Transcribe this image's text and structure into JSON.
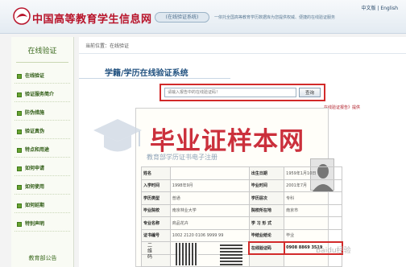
{
  "header": {
    "site_title": "中国高等教育学生信息网",
    "url_badge": "(在线验证系统)",
    "slogan": "一依托全国高等教育学历数据库为您提供权威、便捷的在线验证服务",
    "lang_zh": "中文版",
    "lang_sep": " | ",
    "lang_en": "English"
  },
  "sidebar": {
    "title": "在线验证",
    "items": [
      {
        "label": "在线验证"
      },
      {
        "label": "验证服务简介"
      },
      {
        "label": "防伪措施"
      },
      {
        "label": "验证真伪"
      },
      {
        "label": "特点和用途"
      },
      {
        "label": "如何申请"
      },
      {
        "label": "如何使用"
      },
      {
        "label": "如何延期"
      },
      {
        "label": "特别声明"
      }
    ],
    "footer": "教育部公告"
  },
  "main": {
    "breadcrumb": "当前位置：在线验证",
    "title": "学籍/学历在线验证系统",
    "search_placeholder": "请输入报告中的在线验证码！",
    "search_button": "查询",
    "report_link": "在线验证报告》提供"
  },
  "certificate": {
    "rows": [
      [
        "姓名",
        "",
        "出生日期",
        "1959年1月10日"
      ],
      [
        "入学时间",
        "1998年9月",
        "毕业时间",
        "2001年7月"
      ],
      [
        "学历类型",
        "普通",
        "学历层次",
        "专科"
      ],
      [
        "毕业院校",
        "南京林业大学",
        "院校所在地",
        "南京市"
      ],
      [
        "专业名称",
        "商品花卉",
        "学 习 形 式",
        ""
      ],
      [
        "证书编号",
        "1002 2120 0106 9999 99",
        "毕结业结论",
        "毕业"
      ],
      [
        "",
        "",
        "在线验证码",
        "0908 8869 3519"
      ],
      [
        "",
        "",
        "",
        ""
      ]
    ],
    "vertical_label": "二维码"
  },
  "watermark": {
    "main": "毕业证样本网",
    "sub": "教育部学历证书电子注册",
    "corner": "Baidu经验"
  },
  "colors": {
    "brand_red": "#b8142b",
    "header_blue": "#1e4f7e",
    "sidebar_green": "#3d6b20",
    "highlight_red": "#d22a2a"
  }
}
